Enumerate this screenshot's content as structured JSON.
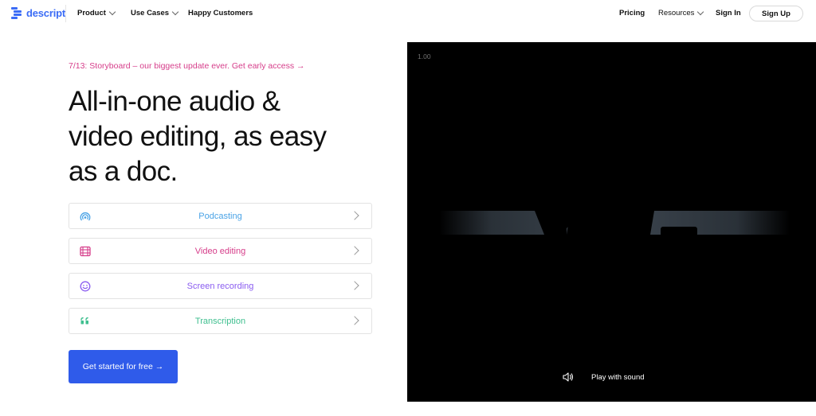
{
  "nav": {
    "logo_text": "descript",
    "product": "Product",
    "use_cases": "Use Cases",
    "happy_customers": "Happy Customers",
    "pricing": "Pricing",
    "resources": "Resources",
    "sign_in": "Sign In",
    "sign_up": "Sign Up"
  },
  "hero": {
    "promo": "7/13: Storyboard – our biggest update ever. Get early access →",
    "headline_lines": [
      "All-in-one audio &",
      "video editing, as easy",
      "as a doc."
    ],
    "cards": [
      {
        "label": "Podcasting",
        "color": "#4aa3e6",
        "icon": "podcast-icon"
      },
      {
        "label": "Video editing",
        "color": "#d63d8a",
        "icon": "film-icon"
      },
      {
        "label": "Screen recording",
        "color": "#8a5cf0",
        "icon": "smiley-icon"
      },
      {
        "label": "Transcription",
        "color": "#3fbf8f",
        "icon": "quote-icon"
      }
    ],
    "cta": "Get started for free →"
  },
  "video": {
    "speed": "1.00",
    "play_with_sound": "Play with sound"
  },
  "colors": {
    "brand": "#3b6cf6",
    "cta": "#2f5bea",
    "promo": "#d63d8a"
  }
}
